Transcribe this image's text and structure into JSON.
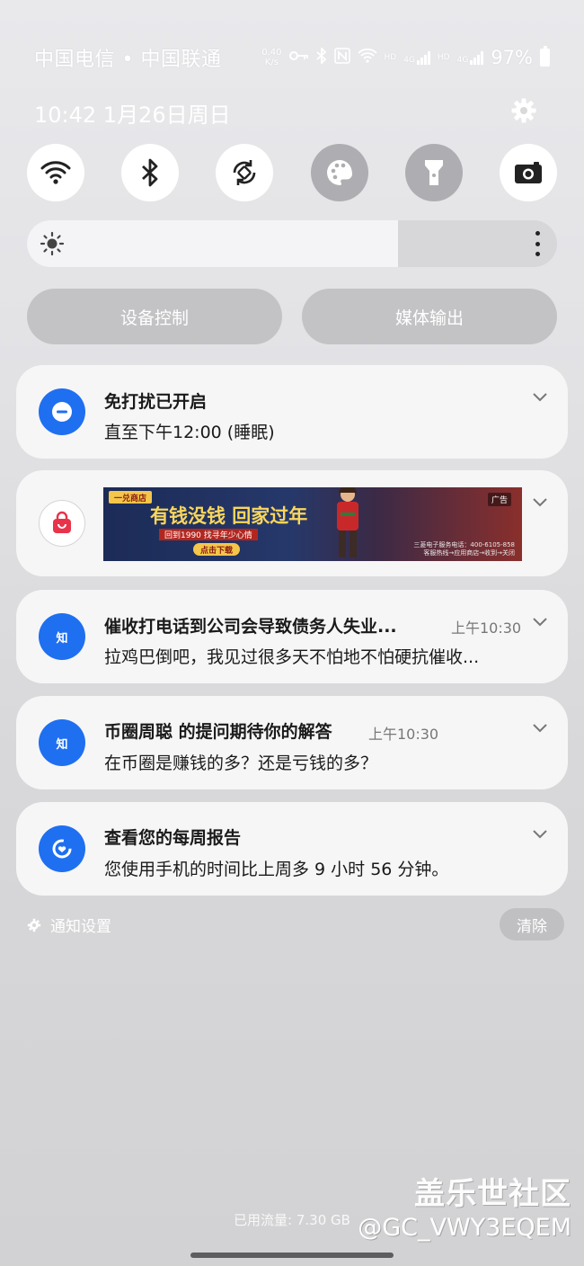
{
  "status_bar": {
    "carriers": "中国电信 • 中国联通",
    "net_speed_value": "0.40",
    "net_speed_unit": "K/s",
    "hd1": "HD",
    "lte1": "4G",
    "hd2": "HD",
    "lte2": "4G",
    "battery": "97%"
  },
  "header": {
    "datetime": "10:42  1月26日周日"
  },
  "quick_settings": [
    {
      "name": "wifi",
      "state": "on"
    },
    {
      "name": "bluetooth",
      "state": "on"
    },
    {
      "name": "auto-rotate",
      "state": "on"
    },
    {
      "name": "theme",
      "state": "off"
    },
    {
      "name": "flashlight",
      "state": "off"
    },
    {
      "name": "camera",
      "state": "on"
    }
  ],
  "brightness": {
    "level": 0.7
  },
  "buttons": {
    "device_control": "设备控制",
    "media_output": "媒体输出"
  },
  "notifications": {
    "dnd": {
      "title": "免打扰已开启",
      "body": "直至下午12:00 (睡眠)"
    },
    "ad": {
      "corner_tag": "广告",
      "shop_tag": "一兑商店",
      "headline": "有钱没钱 回家过年",
      "subline": "回到1990  找寻年少心情",
      "cta": "点击下载",
      "phone": "三菱电子服务电话：400-6105-858",
      "info": "客服热线→应用商店→收到→关闭"
    },
    "zhihu1": {
      "title": "催收打电话到公司会导致债务人失业...",
      "time": "上午10:30",
      "body": "拉鸡巴倒吧，我见过很多天不怕地不怕硬抗催收...",
      "icon_text": "知"
    },
    "zhihu2": {
      "title": "币圈周聪 的提问期待你的解答",
      "time": "上午10:30",
      "body": "在币圈是赚钱的多？还是亏钱的多？",
      "icon_text": "知"
    },
    "report": {
      "title": "查看您的每周报告",
      "body": "您使用手机的时间比上周多 9 小时 56 分钟。"
    }
  },
  "footer": {
    "notif_settings": "通知设置",
    "clear": "清除",
    "data_usage": "已用流量: 7.30 GB"
  },
  "watermark": {
    "site": "盖乐世社区",
    "user": "@GC_VWY3EQEM"
  },
  "colors": {
    "accent_blue": "#1f6ff1",
    "card_bg": "#f6f6f7",
    "ad_red": "#e8334a"
  }
}
